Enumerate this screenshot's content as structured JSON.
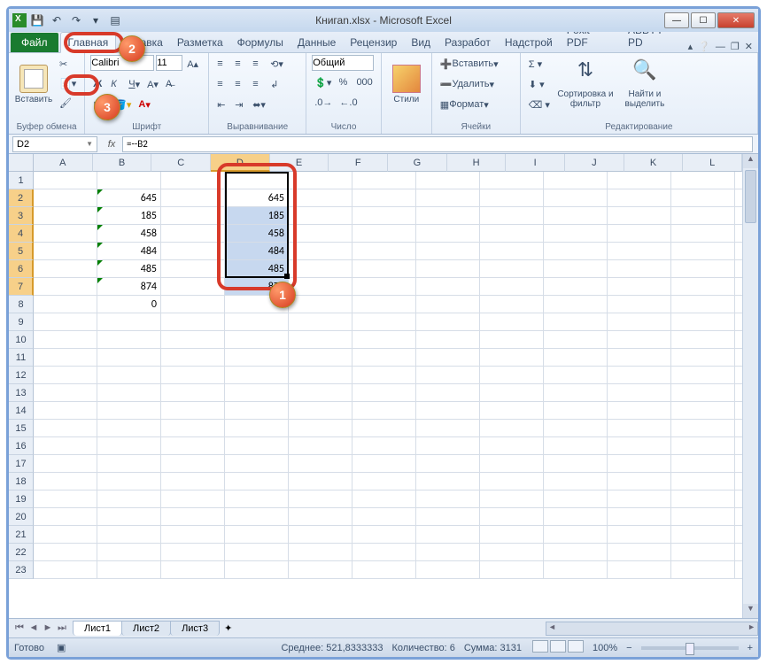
{
  "title": "Книгаn.xlsx - Microsoft Excel",
  "tabs": {
    "file": "Файл",
    "items": [
      "Главная",
      "Вставка",
      "Разметка",
      "Формулы",
      "Данные",
      "Рецензир",
      "Вид",
      "Разработ",
      "Надстрой",
      "Foxit PDF",
      "ABBYY PD"
    ],
    "activeIndex": 0
  },
  "ribbon": {
    "clipboard": {
      "paste": "Вставить",
      "label": "Буфер обмена"
    },
    "font": {
      "name": "Calibri",
      "size": "11",
      "label": "Шрифт"
    },
    "alignment": {
      "label": "Выравнивание"
    },
    "number": {
      "format": "Общий",
      "label": "Число"
    },
    "styles": {
      "btn": "Стили",
      "label": ""
    },
    "cells": {
      "insert": "Вставить",
      "delete": "Удалить",
      "format": "Формат",
      "label": "Ячейки"
    },
    "editing": {
      "sort": "Сортировка и фильтр",
      "find": "Найти и выделить",
      "label": "Редактирование"
    }
  },
  "namebox": "D2",
  "formula": "=--B2",
  "columns": [
    "A",
    "B",
    "C",
    "D",
    "E",
    "F",
    "G",
    "H",
    "I",
    "J",
    "K",
    "L"
  ],
  "selectedCol": "D",
  "rowCount": 23,
  "selectedRows": [
    2,
    3,
    4,
    5,
    6,
    7
  ],
  "dataB": {
    "2": "645",
    "3": "185",
    "4": "458",
    "5": "484",
    "6": "485",
    "7": "874",
    "8": "0"
  },
  "dataD": {
    "2": "645",
    "3": "185",
    "4": "458",
    "5": "484",
    "6": "485",
    "7": "874"
  },
  "sheets": [
    "Лист1",
    "Лист2",
    "Лист3"
  ],
  "status": {
    "ready": "Готово",
    "avg_label": "Среднее:",
    "avg": "521,8333333",
    "count_label": "Количество:",
    "count": "6",
    "sum_label": "Сумма:",
    "sum": "3131",
    "zoom": "100%"
  },
  "chart_data": {
    "type": "table",
    "columns": [
      "B",
      "D"
    ],
    "rows": [
      {
        "row": 2,
        "B": 645,
        "D": 645
      },
      {
        "row": 3,
        "B": 185,
        "D": 185
      },
      {
        "row": 4,
        "B": 458,
        "D": 458
      },
      {
        "row": 5,
        "B": 484,
        "D": 484
      },
      {
        "row": 6,
        "B": 485,
        "D": 485
      },
      {
        "row": 7,
        "B": 874,
        "D": 874
      },
      {
        "row": 8,
        "B": 0,
        "D": null
      }
    ]
  }
}
